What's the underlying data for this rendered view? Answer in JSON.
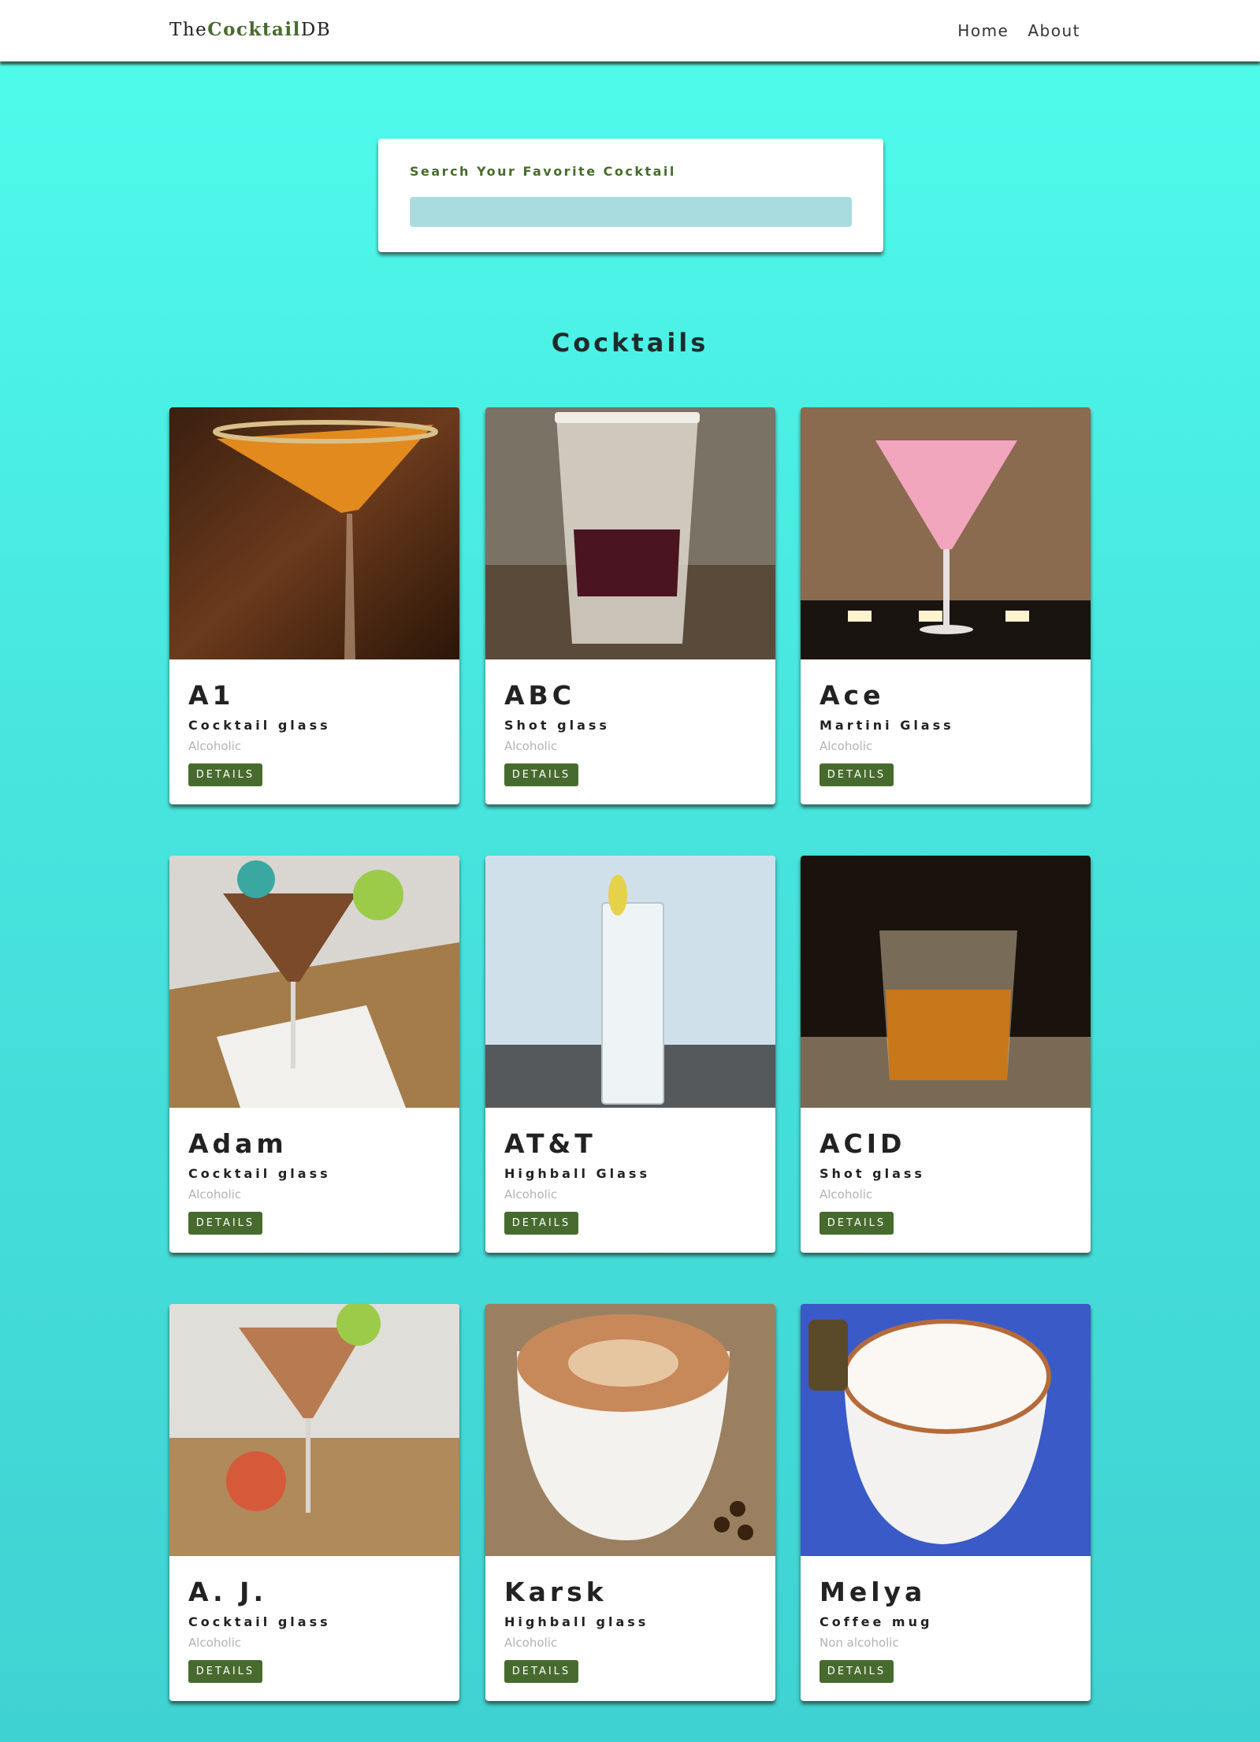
{
  "nav": {
    "logo_prefix": "The",
    "logo_bold": "Cocktail",
    "logo_suffix": "DB",
    "links": [
      "Home",
      "About"
    ]
  },
  "search": {
    "label": "Search Your Favorite Cocktail",
    "value": ""
  },
  "section": {
    "title": "Cocktails"
  },
  "cocktails": [
    {
      "name": "A1",
      "glass": "Cocktail glass",
      "type": "Alcoholic",
      "button": "DETAILS"
    },
    {
      "name": "ABC",
      "glass": "Shot glass",
      "type": "Alcoholic",
      "button": "DETAILS"
    },
    {
      "name": "Ace",
      "glass": "Martini Glass",
      "type": "Alcoholic",
      "button": "DETAILS"
    },
    {
      "name": "Adam",
      "glass": "Cocktail glass",
      "type": "Alcoholic",
      "button": "DETAILS"
    },
    {
      "name": "AT&T",
      "glass": "Highball Glass",
      "type": "Alcoholic",
      "button": "DETAILS"
    },
    {
      "name": "ACID",
      "glass": "Shot glass",
      "type": "Alcoholic",
      "button": "DETAILS"
    },
    {
      "name": "A. J.",
      "glass": "Cocktail glass",
      "type": "Alcoholic",
      "button": "DETAILS"
    },
    {
      "name": "Karsk",
      "glass": "Highball glass",
      "type": "Alcoholic",
      "button": "DETAILS"
    },
    {
      "name": "Melya",
      "glass": "Coffee mug",
      "type": "Non alcoholic",
      "button": "DETAILS"
    }
  ],
  "colors": {
    "brand_green": "#476b2e",
    "background_top": "#4ffdec",
    "background_bottom": "#3fd2d2",
    "search_input": "#a9dcdf"
  }
}
